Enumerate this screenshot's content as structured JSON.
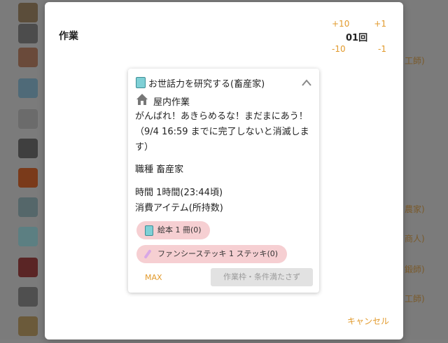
{
  "background": {
    "rows": [
      {
        "left": "",
        "right": ""
      },
      {
        "left": "",
        "right": ""
      },
      {
        "left": "",
        "right": "工師)"
      },
      {
        "left": "",
        "right": ""
      },
      {
        "left": "",
        "right": ""
      },
      {
        "left": "",
        "right": ""
      },
      {
        "left": "",
        "right": ""
      },
      {
        "left": "",
        "right": "農家)"
      },
      {
        "left": "",
        "right": "商人)"
      },
      {
        "left": "",
        "right": "鍛師)"
      },
      {
        "left": "",
        "right": "工師)"
      },
      {
        "left": "",
        "right": ""
      }
    ]
  },
  "modal": {
    "title": "作業",
    "stepper": {
      "plus10": "+10",
      "plus1": "+1",
      "count": "01回",
      "minus10": "-10",
      "minus1": "-1"
    },
    "cancel": "キャンセル"
  },
  "task": {
    "title": "お世話力を研究する(畜産家)",
    "place": "屋内作業",
    "message": "がんばれ！あきらめるな！まだまにあう！（9/4 16:59 までに完了しないと消滅します）",
    "job": "職種 畜産家",
    "time": "時間 1時間(23:44頃)",
    "consume_label": "消費アイテム(所持数)",
    "items": [
      {
        "label": "絵本 1 冊(0)",
        "icon": "book-icon"
      },
      {
        "label": "ファンシーステッキ 1 ステッキ(0)",
        "icon": "wand-icon"
      }
    ],
    "max_label": "MAX",
    "action_label": "作業枠・条件満たさず"
  },
  "colors": {
    "accent": "#e29a2c",
    "pill": "#f6cfd2",
    "disabled": "#e2e2e2"
  }
}
